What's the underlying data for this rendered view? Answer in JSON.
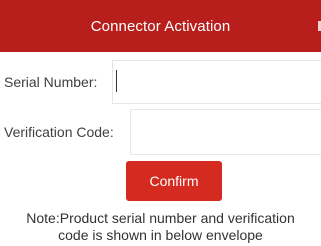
{
  "header": {
    "title": "Connector Activation",
    "background_color": "#b81e1b"
  },
  "form": {
    "serial_number": {
      "label": "Serial Number:",
      "value": ""
    },
    "verification_code": {
      "label": "Verification Code:",
      "value": ""
    },
    "confirm_label": "Confirm",
    "confirm_color": "#d42a20"
  },
  "note": {
    "line1": "Note:Product serial number and verification",
    "line2": "code is shown in below envelope"
  }
}
